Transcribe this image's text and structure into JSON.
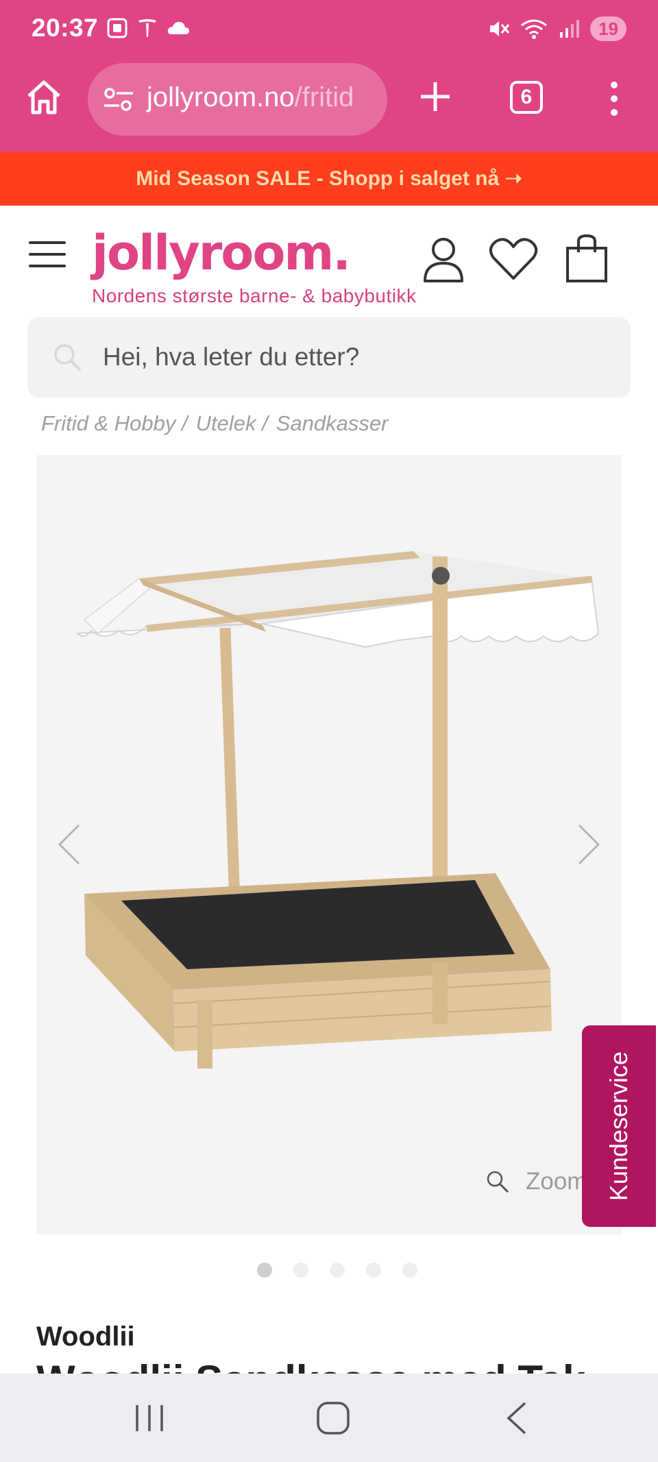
{
  "status_bar": {
    "time": "20:37",
    "battery": "19",
    "icons_left": [
      "screenshot-icon",
      "tesla-icon",
      "cloud-icon"
    ],
    "icons_right": [
      "mute-icon",
      "wifi-icon",
      "signal-icon"
    ]
  },
  "browser": {
    "url_domain": "jollyroom.no",
    "url_path": "/fritid",
    "tab_count": "6"
  },
  "sale_banner": {
    "text": "Mid Season SALE - Shopp i salget nå ➝"
  },
  "header": {
    "logo": "jollyroom.",
    "tagline": "Nordens største barne- & babybutikk",
    "brand_color": "#e04484"
  },
  "search": {
    "placeholder": "Hei, hva leter du etter?"
  },
  "breadcrumb": [
    {
      "label": "Fritid & Hobby"
    },
    {
      "label": "Utelek"
    },
    {
      "label": "Sandkasser"
    }
  ],
  "breadcrumb_separator": "/",
  "gallery": {
    "zoom_label": "Zoom",
    "image_count": 5,
    "active_index": 0
  },
  "kundeservice": {
    "label": "Kundeservice",
    "color": "#b0155f"
  },
  "product": {
    "brand": "Woodlii",
    "title_peek": "Woodlii Sandkasse med Tak"
  }
}
